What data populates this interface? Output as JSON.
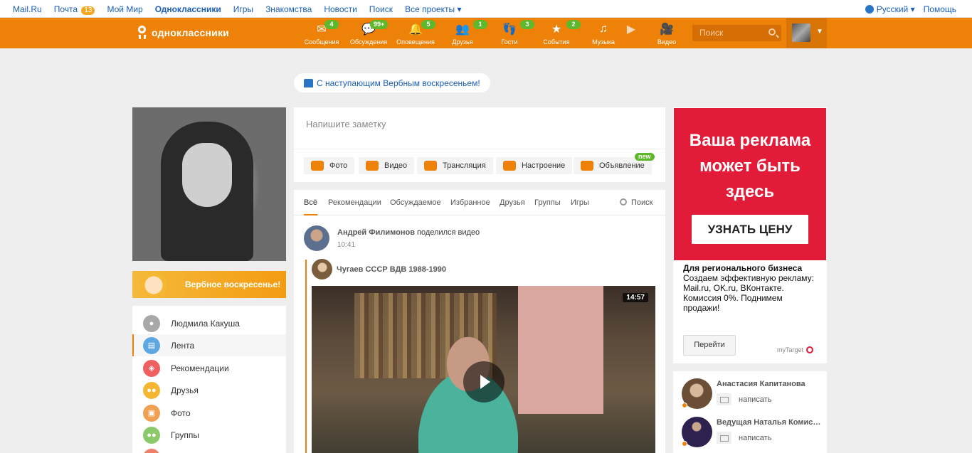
{
  "mailbar": {
    "links": [
      "Mail.Ru",
      "Почта",
      "Мой Мир",
      "Одноклассники",
      "Игры",
      "Знакомства",
      "Новости",
      "Поиск",
      "Все проекты"
    ],
    "mail_count": "13",
    "language": "Русский",
    "help": "Помощь"
  },
  "header": {
    "logo": "одноклассники",
    "nav": [
      {
        "label": "Сообщения",
        "count": "4",
        "icon": "envelope-icon"
      },
      {
        "label": "Обсуждения",
        "count": "99+",
        "icon": "chat-bubbles-icon"
      },
      {
        "label": "Оповещения",
        "count": "5",
        "icon": "bell-icon"
      },
      {
        "label": "Друзья",
        "count": "1",
        "icon": "friends-icon"
      },
      {
        "label": "Гости",
        "count": "3",
        "icon": "footprints-icon"
      },
      {
        "label": "События",
        "count": "2",
        "icon": "events-icon"
      },
      {
        "label": "Музыка",
        "count": "",
        "icon": "music-note-icon"
      },
      {
        "label": "Видео",
        "count": "",
        "icon": "video-camera-icon"
      }
    ],
    "search_placeholder": "Поиск"
  },
  "holiday_banner": "С наступающим Вербным воскресеньем!",
  "left": {
    "promo_label": "Вербное воскресенье!",
    "menu": [
      {
        "label": "Людмила Какуша",
        "color": "#a8a8a8",
        "icon": "user-icon"
      },
      {
        "label": "Лента",
        "color": "#5da8e3",
        "icon": "feed-icon",
        "active": true
      },
      {
        "label": "Рекомендации",
        "color": "#f06060",
        "icon": "compass-icon"
      },
      {
        "label": "Друзья",
        "color": "#f5b731",
        "icon": "friends-icon"
      },
      {
        "label": "Фото",
        "color": "#f0a052",
        "icon": "photo-icon"
      },
      {
        "label": "Группы",
        "color": "#8cc96a",
        "icon": "groups-icon"
      }
    ]
  },
  "composer": {
    "placeholder": "Напишите заметку",
    "buttons": [
      "Фото",
      "Видео",
      "Трансляция",
      "Настроение",
      "Объявление"
    ],
    "new_badge": "new"
  },
  "feed": {
    "tabs": [
      "Всё",
      "Рекомендации",
      "Обсуждаемое",
      "Избранное",
      "Друзья",
      "Группы",
      "Игры"
    ],
    "search": "Поиск",
    "post": {
      "author": "Андрей Филимонов",
      "action": "поделился видео",
      "time": "10:41",
      "group": "Чугаев СССР ВДВ 1988-1990",
      "duration": "14:57"
    }
  },
  "ad": {
    "headline": "Ваша реклама может быть здесь",
    "cta": "УЗНАТЬ ЦЕНУ",
    "title": "Для регионального бизнеса",
    "text": "Создаем эффективную рекламу: Mail.ru, OK.ru, ВКонтакте. Комиссия 0%. Поднимем продажи!",
    "go": "Перейти",
    "brand": "myTarget"
  },
  "friends_online": [
    {
      "name": "Анастасия Капитанова",
      "action": "написать"
    },
    {
      "name": "Ведущая Наталья Комиссарова",
      "action": "написать"
    }
  ],
  "colors": {
    "brand_orange": "#ee8208",
    "badge_green": "#5eb82b",
    "ad_red": "#e21b38",
    "link_blue": "#1a5eb7"
  }
}
